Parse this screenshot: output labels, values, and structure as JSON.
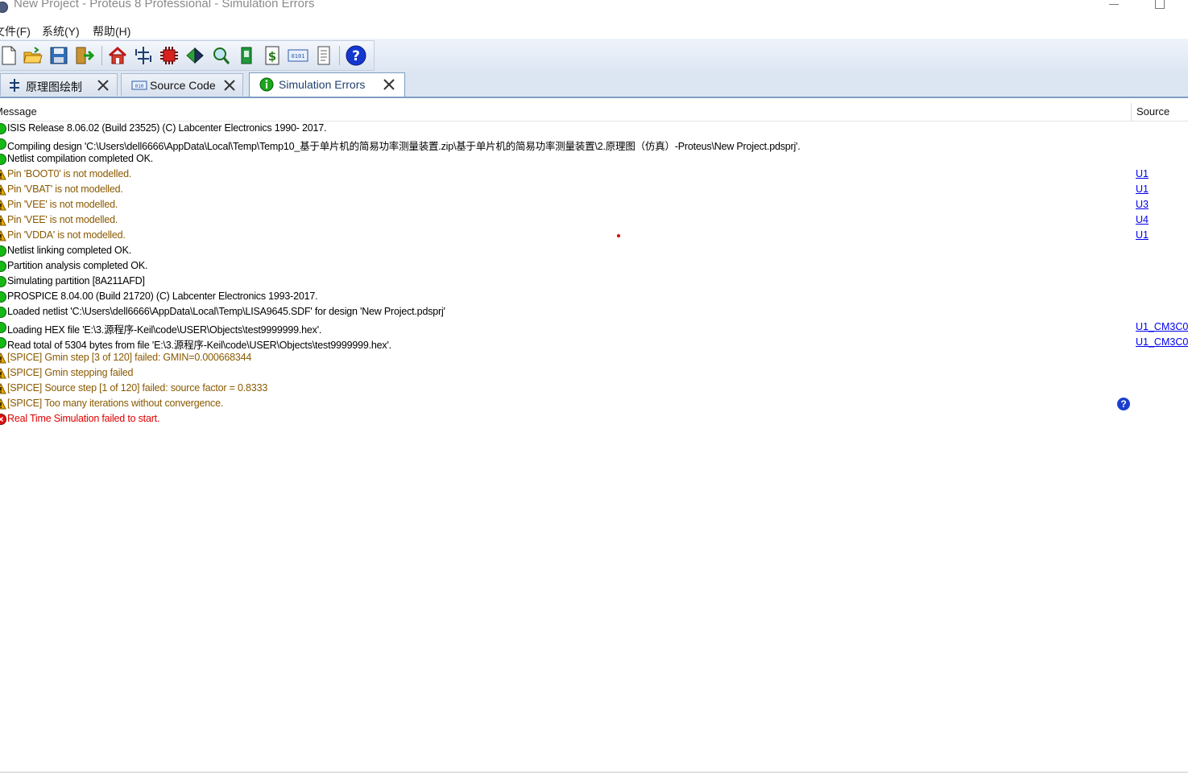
{
  "window": {
    "title": "New Project - Proteus 8 Professional - Simulation Errors"
  },
  "menu": {
    "items": [
      "文件(F)",
      "系统(Y)",
      "帮助(H)"
    ]
  },
  "toolbar": {
    "buttons": [
      "new-file-icon",
      "open-folder-icon",
      "save-icon",
      "close-project-icon",
      "home-icon",
      "schematic-icon",
      "pcb-layout-icon",
      "gerber-viewer-icon",
      "design-explorer-icon",
      "3d-visualizer-icon",
      "bill-of-materials-icon",
      "source-code-icon",
      "notes-icon",
      "help-icon"
    ]
  },
  "tabs": [
    {
      "label": "原理图绘制",
      "icon": "schematic-icon",
      "active": false
    },
    {
      "label": "Source Code",
      "icon": "binary-code-icon",
      "active": false
    },
    {
      "label": "Simulation Errors",
      "icon": "info-icon",
      "active": true
    }
  ],
  "list": {
    "columns": {
      "message": "Message",
      "source": "Source"
    },
    "rows": [
      {
        "severity": "info",
        "message": "ISIS Release 8.06.02 (Build 23525) (C) Labcenter Electronics 1990- 2017.",
        "source": ""
      },
      {
        "severity": "info",
        "message": "Compiling design 'C:\\Users\\dell6666\\AppData\\Local\\Temp\\Temp10_基于单片机的简易功率测量装置.zip\\基于单片机的简易功率测量装置\\2.原理图（仿真）-Proteus\\New Project.pdsprj'.",
        "source": ""
      },
      {
        "severity": "info",
        "message": "Netlist compilation completed OK.",
        "source": ""
      },
      {
        "severity": "warning",
        "message": "Pin 'BOOT0' is not modelled.",
        "source": "U1"
      },
      {
        "severity": "warning",
        "message": "Pin 'VBAT' is not modelled.",
        "source": "U1"
      },
      {
        "severity": "warning",
        "message": "Pin 'VEE' is not modelled.",
        "source": "U3"
      },
      {
        "severity": "warning",
        "message": "Pin 'VEE' is not modelled.",
        "source": "U4"
      },
      {
        "severity": "warning",
        "message": "Pin 'VDDA' is not modelled.",
        "source": "U1"
      },
      {
        "severity": "info",
        "message": "Netlist linking completed OK.",
        "source": ""
      },
      {
        "severity": "info",
        "message": "Partition analysis completed OK.",
        "source": ""
      },
      {
        "severity": "info",
        "message": "Simulating partition [8A211AFD]",
        "source": ""
      },
      {
        "severity": "info",
        "message": "PROSPICE 8.04.00 (Build 21720) (C) Labcenter Electronics 1993-2017.",
        "source": ""
      },
      {
        "severity": "info",
        "message": "Loaded netlist 'C:\\Users\\dell6666\\AppData\\Local\\Temp\\LISA9645.SDF' for design 'New Project.pdsprj'",
        "source": ""
      },
      {
        "severity": "info",
        "message": "Loading HEX file 'E:\\3.源程序-Keil\\code\\USER\\Objects\\test9999999.hex'.",
        "source": "U1_CM3C0"
      },
      {
        "severity": "info",
        "message": "Read total of 5304 bytes from file 'E:\\3.源程序-Keil\\code\\USER\\Objects\\test9999999.hex'.",
        "source": "U1_CM3C0"
      },
      {
        "severity": "warning",
        "message": "[SPICE] Gmin step [3 of 120] failed: GMIN=0.000668344",
        "source": ""
      },
      {
        "severity": "warning",
        "message": "[SPICE] Gmin stepping failed",
        "source": ""
      },
      {
        "severity": "warning",
        "message": "[SPICE] Source step [1 of 120] failed: source factor =   0.8333",
        "source": ""
      },
      {
        "severity": "warning",
        "message": "[SPICE] Too many iterations without convergence.",
        "source": ""
      },
      {
        "severity": "error",
        "message": "Real Time Simulation failed to start.",
        "source": ""
      }
    ]
  },
  "colors": {
    "info": "#16b816",
    "warning": "#e8a800",
    "error": "#e01010",
    "link": "#0000ee",
    "help": "#1a3fd0"
  }
}
